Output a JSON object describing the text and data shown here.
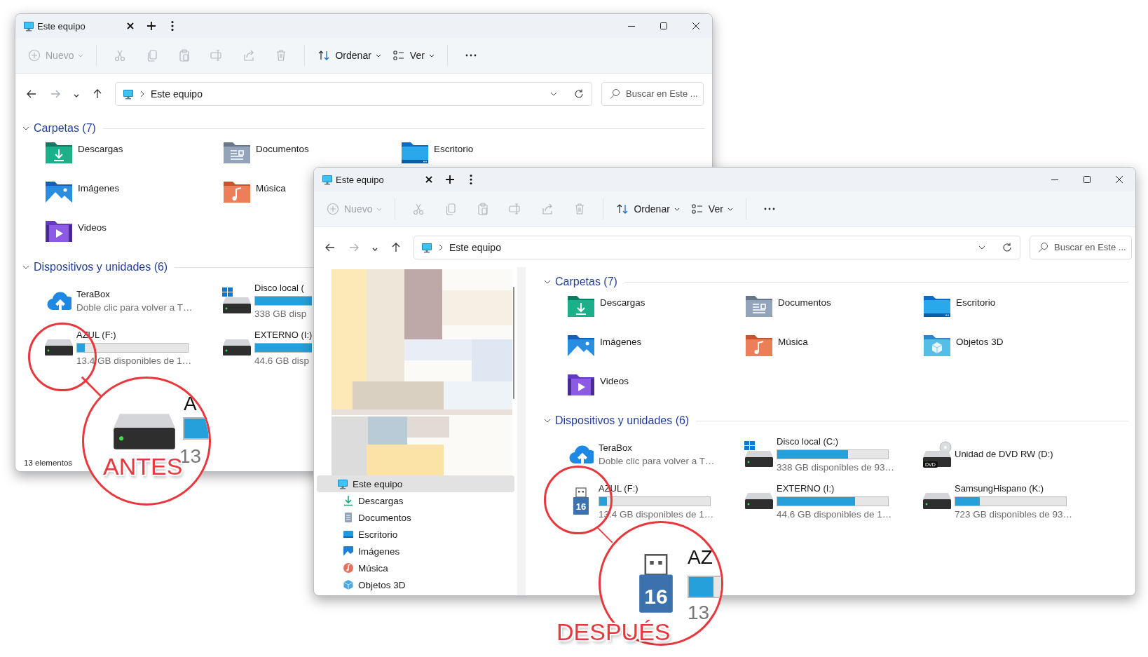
{
  "windows": [
    {
      "title": "Este equipo",
      "toolbar": [
        {
          "kind": "new",
          "label": "Nuevo",
          "disabled": true
        },
        {
          "kind": "separator"
        },
        {
          "kind": "cut",
          "disabled": true
        },
        {
          "kind": "copy",
          "disabled": true
        },
        {
          "kind": "paste",
          "disabled": true
        },
        {
          "kind": "rename",
          "disabled": true
        },
        {
          "kind": "share",
          "disabled": true
        },
        {
          "kind": "delete",
          "disabled": true
        },
        {
          "kind": "separator"
        },
        {
          "kind": "sort",
          "label": "Ordenar",
          "disabled": false
        },
        {
          "kind": "view",
          "label": "Ver",
          "disabled": false
        },
        {
          "kind": "separator"
        },
        {
          "kind": "more",
          "disabled": false
        }
      ],
      "nav": [
        {
          "kind": "back",
          "disabled": false
        },
        {
          "kind": "forward",
          "disabled": true
        },
        {
          "kind": "history",
          "disabled": false
        },
        {
          "kind": "up",
          "disabled": false
        }
      ],
      "address": {
        "path": "Este equipo"
      },
      "search": {
        "placeholder": "Buscar en Este ..."
      },
      "sections": [
        {
          "title": "Carpetas (7)",
          "kind": "folders",
          "expanded": true,
          "rows": [
            [
              {
                "name": "Descargas",
                "kind": "downloads"
              },
              {
                "name": "Documentos",
                "kind": "documents"
              },
              {
                "name": "Escritorio",
                "kind": "desktop"
              }
            ],
            [
              {
                "name": "Imágenes",
                "kind": "pictures"
              },
              {
                "name": "Música",
                "kind": "music"
              }
            ],
            [
              {
                "name": "Videos",
                "kind": "videos"
              }
            ]
          ]
        },
        {
          "title": "Dispositivos y unidades (6)",
          "kind": "drives",
          "expanded": true,
          "rows": [
            [
              {
                "name": "TeraBox",
                "kind": "cloud",
                "detail": "Doble clic para volver a T…"
              },
              {
                "name": "Disco local (",
                "kind": "system",
                "level": 0.64,
                "detail": "338 GB disp"
              }
            ],
            [
              {
                "name": "AZUL (F:)",
                "kind": "hdd",
                "level": 0.07,
                "detail": "13.4 GB disponibles de 1…"
              },
              {
                "name": "EXTERNO (I:)",
                "kind": "hdd",
                "level": 0.7,
                "detail": "44.6 GB disp"
              }
            ]
          ]
        }
      ],
      "status_bar": "13 elementos"
    },
    {
      "title": "Este equipo",
      "toolbar": [
        {
          "kind": "new",
          "label": "Nuevo",
          "disabled": true
        },
        {
          "kind": "separator"
        },
        {
          "kind": "cut",
          "disabled": true
        },
        {
          "kind": "copy",
          "disabled": true
        },
        {
          "kind": "paste",
          "disabled": true
        },
        {
          "kind": "rename",
          "disabled": true
        },
        {
          "kind": "share",
          "disabled": true
        },
        {
          "kind": "delete",
          "disabled": true
        },
        {
          "kind": "separator"
        },
        {
          "kind": "sort",
          "label": "Ordenar",
          "disabled": false
        },
        {
          "kind": "view",
          "label": "Ver",
          "disabled": false
        },
        {
          "kind": "separator"
        },
        {
          "kind": "more",
          "disabled": false
        }
      ],
      "nav": [
        {
          "kind": "back",
          "disabled": false
        },
        {
          "kind": "forward",
          "disabled": true
        },
        {
          "kind": "history",
          "disabled": false
        },
        {
          "kind": "up",
          "disabled": false
        }
      ],
      "address": {
        "path": "Este equipo"
      },
      "search": {
        "placeholder": "Buscar en Este ..."
      },
      "sidebar": {
        "tree": [
          {
            "label": "Este equipo",
            "kind": "pc",
            "selected": true,
            "children": [
              {
                "label": "Descargas",
                "kind": "downloads",
                "selected": false
              },
              {
                "label": "Documentos",
                "kind": "documents",
                "selected": false
              },
              {
                "label": "Escritorio",
                "kind": "desktop",
                "selected": false
              },
              {
                "label": "Imágenes",
                "kind": "pictures",
                "selected": false
              },
              {
                "label": "Música",
                "kind": "music",
                "selected": false
              },
              {
                "label": "Objetos 3D",
                "kind": "objects3d",
                "selected": false
              }
            ]
          }
        ]
      },
      "sections": [
        {
          "title": "Carpetas (7)",
          "kind": "folders",
          "expanded": true,
          "rows": [
            [
              {
                "name": "Descargas",
                "kind": "downloads"
              },
              {
                "name": "Documentos",
                "kind": "documents"
              },
              {
                "name": "Escritorio",
                "kind": "desktop"
              }
            ],
            [
              {
                "name": "Imágenes",
                "kind": "pictures"
              },
              {
                "name": "Música",
                "kind": "music"
              },
              {
                "name": "Objetos 3D",
                "kind": "objects3d"
              }
            ],
            [
              {
                "name": "Videos",
                "kind": "videos"
              }
            ]
          ]
        },
        {
          "title": "Dispositivos y unidades (6)",
          "kind": "drives",
          "expanded": true,
          "rows": [
            [
              {
                "name": "TeraBox",
                "kind": "cloud",
                "detail": "Doble clic para volver a T…"
              },
              {
                "name": "Disco local (C:)",
                "kind": "system",
                "level": 0.64,
                "detail": "338 GB disponibles de 93…"
              },
              {
                "name": "Unidad de DVD RW (D:)",
                "kind": "dvd",
                "badge": "DVD"
              }
            ],
            [
              {
                "name": "AZUL (F:)",
                "kind": "usb",
                "badge": "16",
                "level": 0.07,
                "detail": "13.4 GB disponibles de 1…"
              },
              {
                "name": "EXTERNO (I:)",
                "kind": "hdd",
                "level": 0.7,
                "detail": "44.6 GB disponibles de 1…"
              },
              {
                "name": "SamsungHispano (K:)",
                "kind": "hdd",
                "level": 0.22,
                "detail": "723 GB disponibles de 93…"
              }
            ]
          ]
        }
      ]
    }
  ],
  "annotations": [
    {
      "label": "ANTES",
      "kind": "hdd",
      "zoom_name": "A",
      "zoom_detail": "13",
      "level": 0.07
    },
    {
      "label": "DESPUÉS",
      "kind": "usb",
      "badge": "16",
      "zoom_name": "AZ",
      "zoom_detail": "13",
      "level": 0.07
    }
  ]
}
